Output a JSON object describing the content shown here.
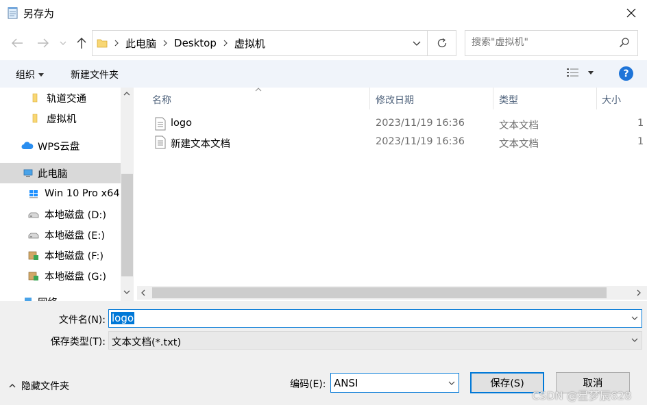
{
  "window": {
    "title": "另存为"
  },
  "address": {
    "crumbs": [
      "此电脑",
      "Desktop",
      "虚拟机"
    ]
  },
  "search": {
    "placeholder": "搜索\"虚拟机\""
  },
  "toolbar": {
    "organize": "组织",
    "new_folder": "新建文件夹",
    "help": "?"
  },
  "nav": {
    "items": [
      {
        "label": "轨道交通",
        "icon": "folder-icon"
      },
      {
        "label": "虚拟机",
        "icon": "folder-icon"
      },
      {
        "label": "WPS云盘",
        "icon": "cloud-icon"
      },
      {
        "label": "此电脑",
        "icon": "computer-icon",
        "selected": true
      },
      {
        "label": "Win 10 Pro x64",
        "icon": "windows-icon"
      },
      {
        "label": "本地磁盘 (D:)",
        "icon": "drive-icon"
      },
      {
        "label": "本地磁盘 (E:)",
        "icon": "drive-icon"
      },
      {
        "label": "本地磁盘 (F:)",
        "icon": "shared-drive-icon"
      },
      {
        "label": "本地磁盘 (G:)",
        "icon": "shared-drive-icon"
      },
      {
        "label": "网络",
        "icon": "network-icon"
      }
    ]
  },
  "files": {
    "columns": [
      "名称",
      "修改日期",
      "类型",
      "大小"
    ],
    "rows": [
      {
        "name": "logo",
        "date": "2023/11/19 16:36",
        "type": "文本文档",
        "size": "1"
      },
      {
        "name": "新建文本文档",
        "date": "2023/11/19 16:36",
        "type": "文本文档",
        "size": "1"
      }
    ]
  },
  "form": {
    "filename_label": "文件名(N):",
    "filename_value": "logo",
    "filetype_label": "保存类型(T):",
    "filetype_value": "文本文档(*.txt)",
    "encoding_label": "编码(E):",
    "encoding_value": "ANSI",
    "hide_folders": "隐藏文件夹",
    "save": "保存(S)",
    "cancel": "取消"
  },
  "watermark": "CSDN @星梦辰628",
  "colors": {
    "accent": "#0078d7",
    "help": "#1e74d8",
    "selected_bg": "#d9d9d9"
  }
}
